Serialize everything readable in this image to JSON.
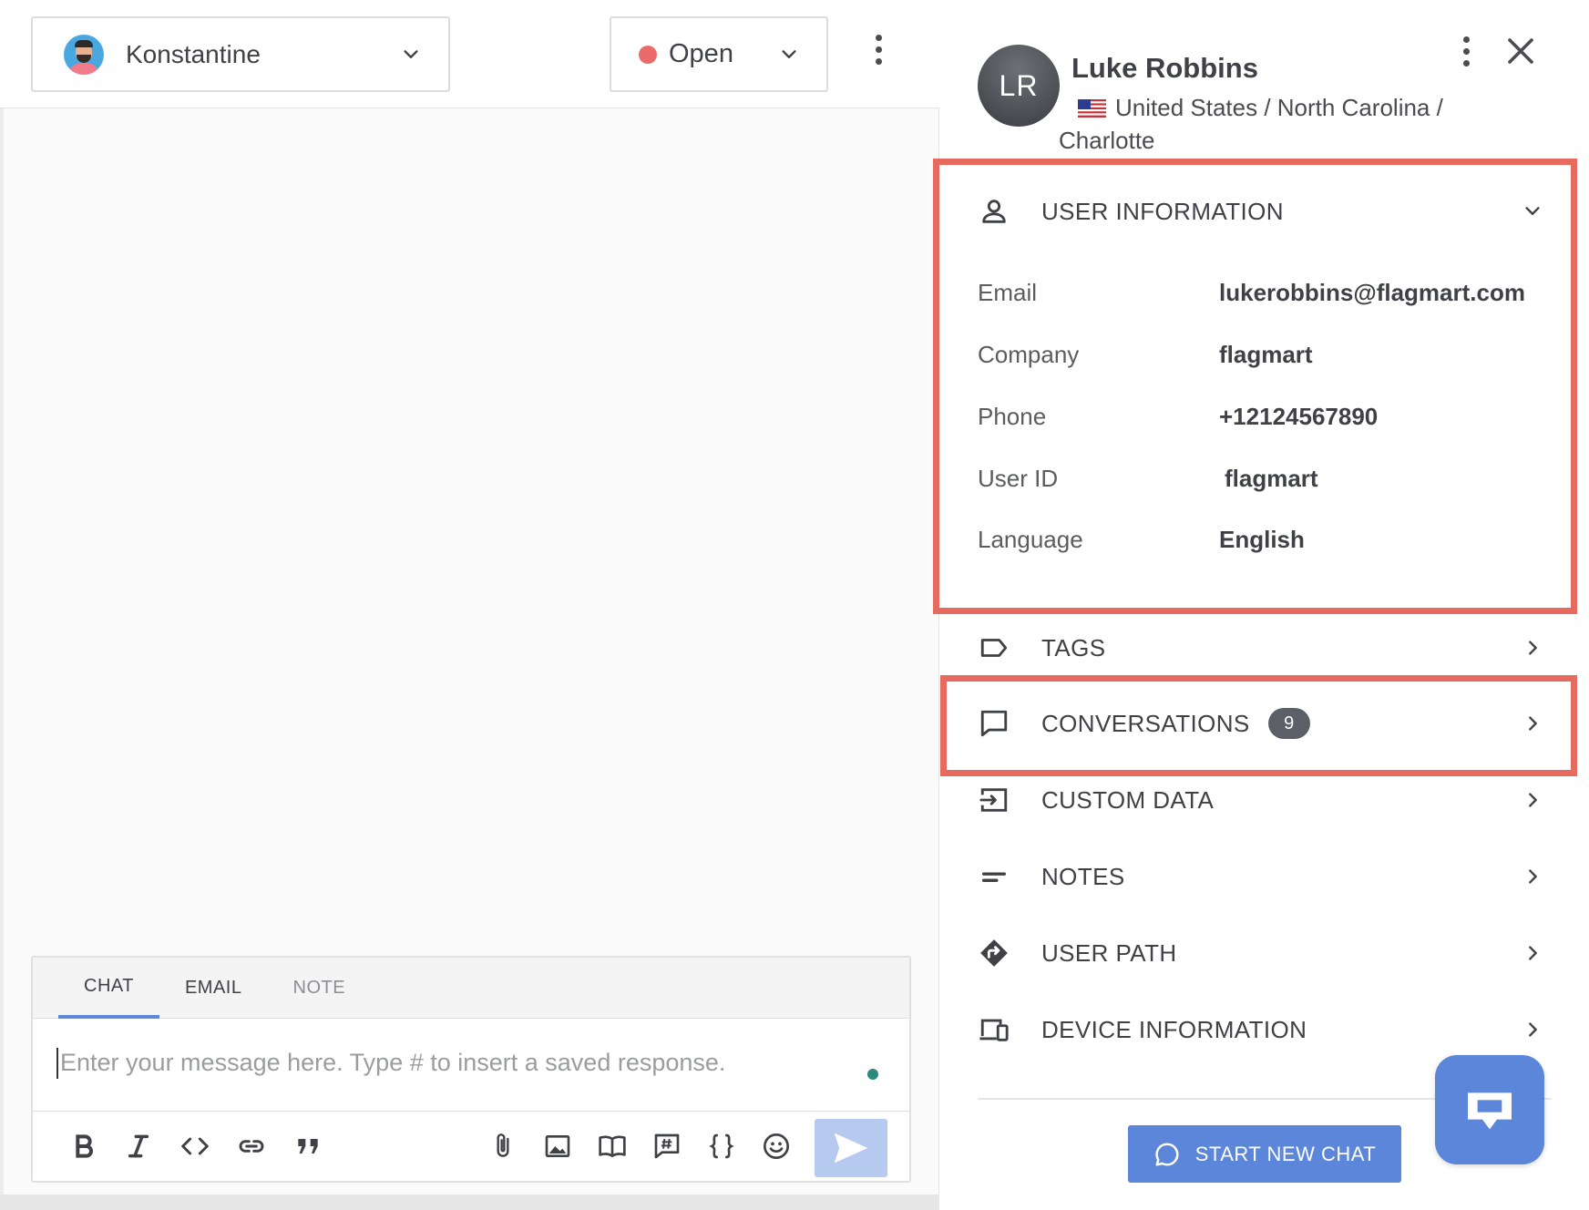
{
  "toolbar": {
    "assignee": "Konstantine",
    "status": "Open",
    "status_color": "#ec6a6a"
  },
  "composer": {
    "tabs": [
      "CHAT",
      "EMAIL",
      "NOTE"
    ],
    "active_tab": "CHAT",
    "placeholder": "Enter your message here. Type # to insert a saved response.",
    "format_icons": [
      "bold-icon",
      "italic-icon",
      "code-icon",
      "link-icon",
      "quote-icon"
    ],
    "insert_icons": [
      "attachment-icon",
      "image-icon",
      "knowledge-base-icon",
      "saved-response-icon",
      "variable-icon",
      "emoji-icon"
    ],
    "send_icon": "send-icon"
  },
  "profile": {
    "initials": "LR",
    "name": "Luke Robbins",
    "location_line1": "United States / North Carolina /",
    "location_line2": "Charlotte",
    "flag": "us-flag-icon"
  },
  "user_information": {
    "title": "USER INFORMATION",
    "fields": [
      {
        "label": "Email",
        "value": "lukerobbins@flagmart.com"
      },
      {
        "label": "Company",
        "value": "flagmart"
      },
      {
        "label": "Phone",
        "value": "+12124567890"
      },
      {
        "label": "User ID",
        "value": "flagmart"
      },
      {
        "label": "Language",
        "value": "English"
      }
    ]
  },
  "sections": {
    "tags": "TAGS",
    "conversations": "CONVERSATIONS",
    "conversations_count": "9",
    "custom_data": "CUSTOM DATA",
    "notes": "NOTES",
    "user_path": "USER PATH",
    "device_information": "DEVICE INFORMATION"
  },
  "start_new_chat": "START NEW CHAT",
  "colors": {
    "accent": "#5b86d9",
    "highlight": "#e66a5e",
    "send_disabled": "#b6c9ef"
  }
}
